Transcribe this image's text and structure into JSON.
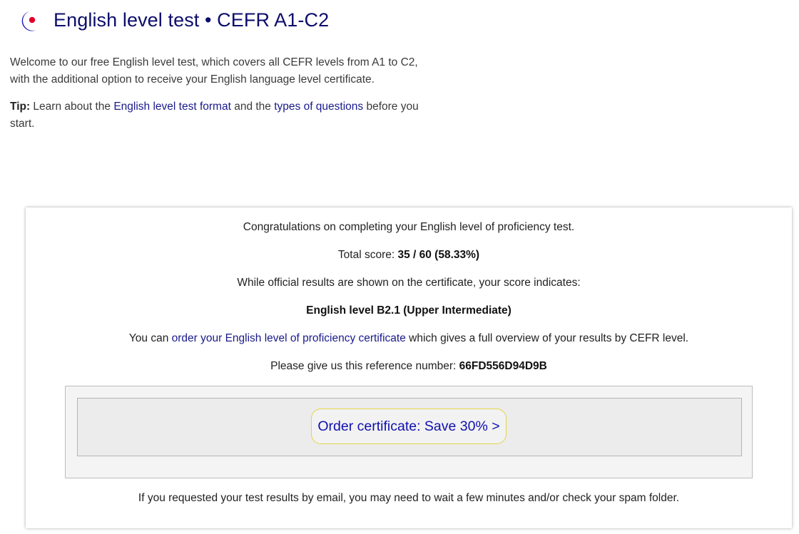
{
  "header": {
    "title": "English level test • CEFR A1-C2",
    "logo_colors": {
      "crescent": "#1d1db8",
      "dot": "#e0002a"
    }
  },
  "intro": {
    "paragraph": "Welcome to our free English level test, which covers all CEFR levels from A1 to C2, with the additional option to receive your English language level certificate.",
    "tip_label": "Tip:",
    "tip_text_1": " Learn about the ",
    "tip_link_1": "English level test format",
    "tip_text_2": " and the ",
    "tip_link_2": "types of questions",
    "tip_text_3": " before you start."
  },
  "results": {
    "congrats": "Congratulations on completing your English level of proficiency test.",
    "score_label": "Total score: ",
    "score_value": "35 / 60 (58.33%)",
    "indicates": "While official results are shown on the certificate, your score indicates:",
    "level": "English level B2.1 (Upper Intermediate)",
    "order_text_1": "You can ",
    "order_link": "order your English level of proficiency certificate",
    "order_text_2": " which gives a full overview of your results by CEFR level.",
    "reference_label": "Please give us this reference number: ",
    "reference_value": "66FD556D94D9B",
    "order_button": "Order certificate: Save 30% >",
    "email_note": "If you requested your test results by email, you may need to wait a few minutes and/or check your spam folder."
  },
  "colors": {
    "title": "#0d0d6b",
    "link": "#1a1a8c",
    "button_text": "#1010b0",
    "button_border": "#e3d64a"
  }
}
